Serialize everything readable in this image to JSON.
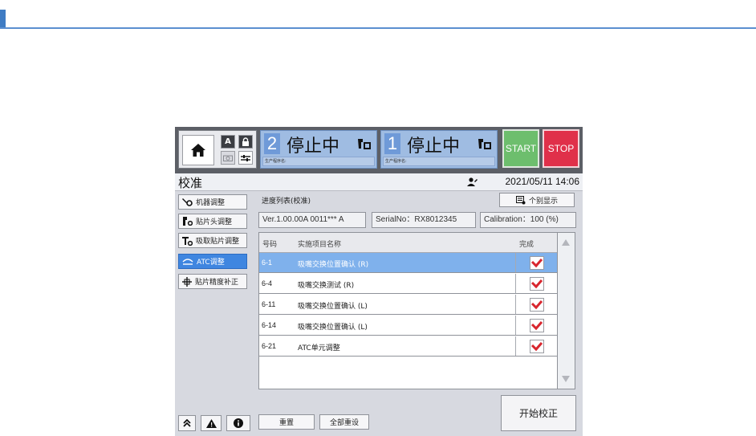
{
  "header": {
    "lane2": {
      "number": "2",
      "state": "停止中",
      "program_label": "生产程序名:"
    },
    "lane1": {
      "number": "1",
      "state": "停止中",
      "program_label": "生产程序名:"
    },
    "start_label": "START",
    "stop_label": "STOP"
  },
  "titlebar": {
    "title": "校准",
    "datetime": "2021/05/11 14:06"
  },
  "menu": {
    "items": [
      {
        "label": "机器调整"
      },
      {
        "label": "贴片头调整"
      },
      {
        "label": "吸取贴片调整"
      },
      {
        "label": "ATC调整",
        "active": true
      },
      {
        "label": "贴片精度补正"
      }
    ]
  },
  "content": {
    "subtitle": "进度列表(校准)",
    "individual_display_label": "个别显示",
    "version": "Ver.1.00.00A 0011*** A",
    "serial": "SerialNo：RX8012345",
    "calibration": "Calibration：100 (%)",
    "table": {
      "headers": {
        "code": "号码",
        "name": "实施项目名称",
        "done": "完成"
      },
      "rows": [
        {
          "code": "6-1",
          "name": "吸嘴交换位置确认 (R)",
          "done": true,
          "selected": true
        },
        {
          "code": "6-4",
          "name": "吸嘴交换测试 (R)",
          "done": true
        },
        {
          "code": "6-11",
          "name": "吸嘴交换位置确认 (L)",
          "done": true
        },
        {
          "code": "6-14",
          "name": "吸嘴交换位置确认 (L)",
          "done": true
        },
        {
          "code": "6-21",
          "name": "ATC单元调整",
          "done": true
        }
      ]
    },
    "reset_label": "重置",
    "reset_all_label": "全部重设",
    "start_calibration_label": "开始校正"
  },
  "colors": {
    "accent": "#3f86e0",
    "start": "#6dbe6d",
    "stop": "#e0304a",
    "check": "#d8262e"
  }
}
